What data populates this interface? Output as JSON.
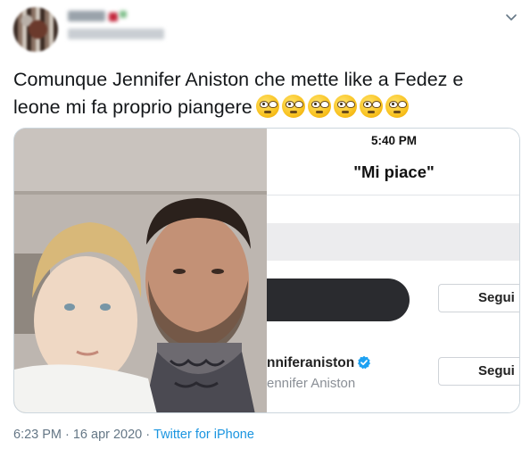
{
  "tweet": {
    "text_line1": "Comunque Jennifer Aniston che mette like a Fedez e",
    "text_line2": "leone mi fa proprio piangere",
    "emoji_name": "pleading-face",
    "emoji_count": 6
  },
  "screenshot": {
    "status_time": "5:40 PM",
    "title": "\"Mi piace\"",
    "rows": [
      {
        "follow_label": "Segui"
      },
      {
        "handle": "nniferaniston",
        "display_name": "ennifer Aniston",
        "follow_label": "Segui",
        "verified": true
      }
    ]
  },
  "footer": {
    "time": "6:23 PM",
    "separator": "·",
    "date": "16 apr 2020",
    "source": "Twitter for iPhone"
  },
  "colors": {
    "link": "#1b95e0",
    "verified": "#1da1f2",
    "meta_text": "#657786"
  }
}
